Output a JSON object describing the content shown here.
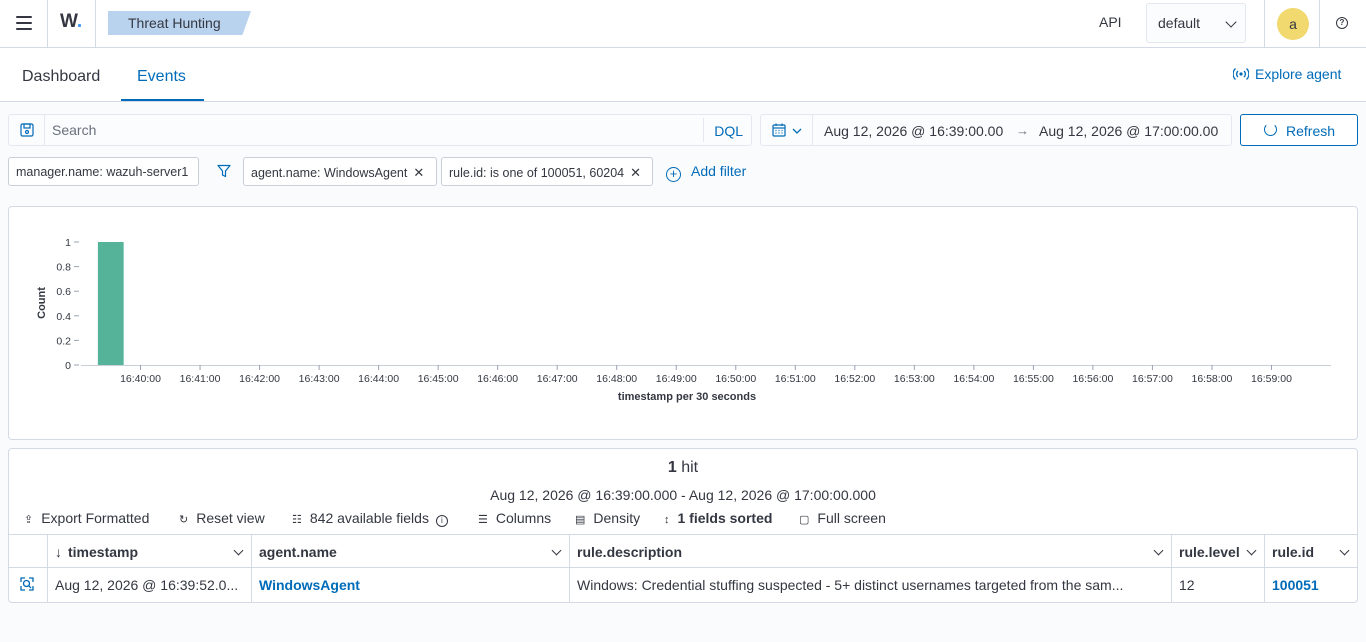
{
  "header": {
    "logo_text": "W",
    "breadcrumb": "Threat Hunting",
    "api_label": "API",
    "api_selector_value": "default",
    "avatar_initial": "a",
    "help_glyph": "?"
  },
  "tabs": {
    "items": [
      {
        "label": "Dashboard"
      },
      {
        "label": "Events"
      }
    ],
    "active": "Events",
    "explore_agent": "Explore agent"
  },
  "query": {
    "search_placeholder": "Search",
    "language": "DQL",
    "date_start": "Aug 12, 2026 @ 16:39:00.00",
    "date_arrow": "→",
    "date_end": "Aug 12, 2026 @ 17:00:00.00",
    "refresh_label": "Refresh"
  },
  "filters": {
    "items": [
      {
        "label": "manager.name: wazuh-server1",
        "removable": false
      },
      {
        "label": "agent.name: WindowsAgent",
        "removable": true
      },
      {
        "label": "rule.id: is one of 100051, 60204",
        "removable": true
      }
    ],
    "add_filter": "Add filter"
  },
  "chart_data": {
    "type": "bar",
    "title": "",
    "ylabel": "Count",
    "xlabel": "timestamp per 30 seconds",
    "ylim": [
      0,
      1
    ],
    "yticks": [
      "0",
      "0.2",
      "0.4",
      "0.6",
      "0.8",
      "1"
    ],
    "xticks": [
      "16:40:00",
      "16:41:00",
      "16:42:00",
      "16:43:00",
      "16:44:00",
      "16:45:00",
      "16:46:00",
      "16:47:00",
      "16:48:00",
      "16:49:00",
      "16:50:00",
      "16:51:00",
      "16:52:00",
      "16:53:00",
      "16:54:00",
      "16:55:00",
      "16:56:00",
      "16:57:00",
      "16:58:00",
      "16:59:00"
    ],
    "bars": [
      {
        "x": "16:39:30",
        "value": 1
      }
    ],
    "bar_color": "#54b399",
    "grid": false
  },
  "results": {
    "hit_count": "1",
    "hit_label": "hit",
    "range": "Aug 12, 2026 @ 16:39:00.000 - Aug 12, 2026 @ 17:00:00.000",
    "toolbar": {
      "export": "Export Formatted",
      "reset": "Reset view",
      "fields": "842 available fields",
      "columns": "Columns",
      "density": "Density",
      "sorted": "1 fields sorted",
      "fullscreen": "Full screen"
    },
    "columns": [
      "timestamp",
      "agent.name",
      "rule.description",
      "rule.level",
      "rule.id"
    ],
    "rows": [
      {
        "timestamp": "Aug 12, 2026 @ 16:39:52.0...",
        "agent_name": "WindowsAgent",
        "rule_description": "Windows: Credential stuffing suspected - 5+ distinct usernames targeted from the sam...",
        "rule_level": "12",
        "rule_id": "100051"
      }
    ]
  }
}
